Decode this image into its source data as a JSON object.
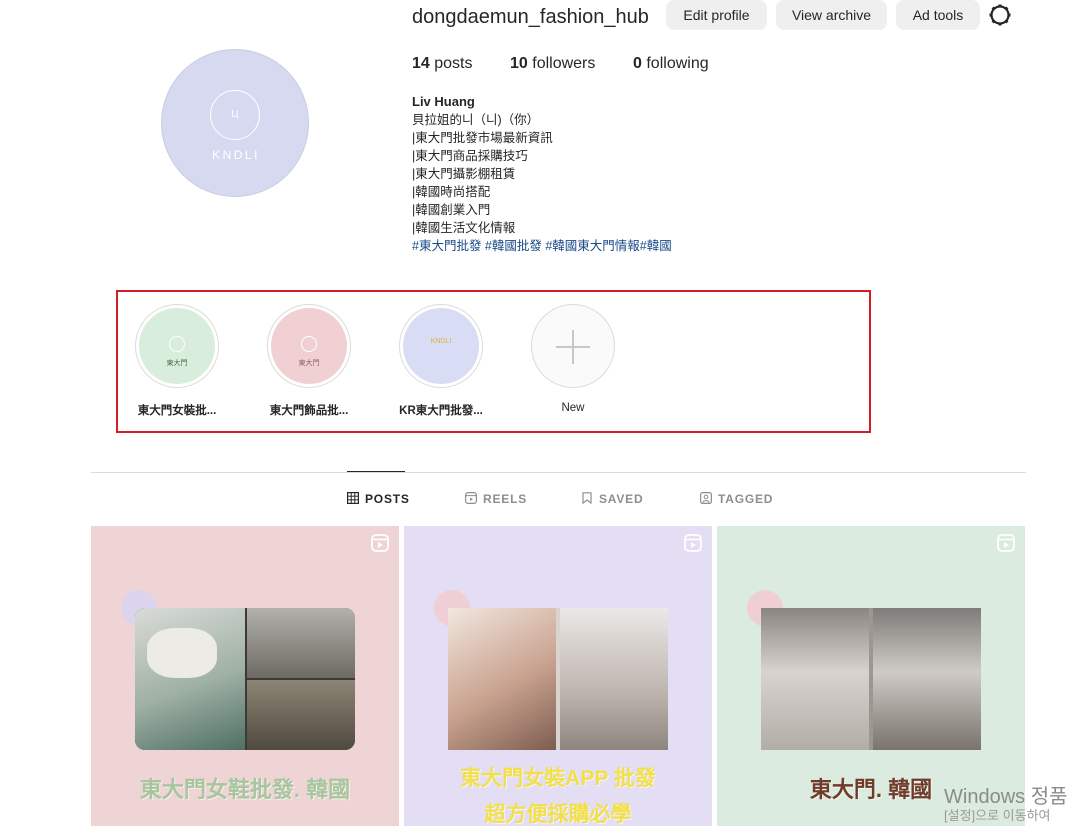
{
  "profile": {
    "username": "dongdaemun_fashion_hub",
    "avatar_text": "KNDLI",
    "avatar_badge": "Ц",
    "buttons": {
      "edit": "Edit profile",
      "archive": "View archive",
      "ad_tools": "Ad tools"
    },
    "stats": {
      "posts_count": "14",
      "posts_label": "posts",
      "followers_count": "10",
      "followers_label": "followers",
      "following_count": "0",
      "following_label": "following"
    },
    "bio": {
      "name": "Liv Huang",
      "lines": [
        "貝拉姐的니（니)（你）",
        "|東大門批發市場最新資訊",
        "|東大門商品採購技巧",
        "|東大門攝影棚租賃",
        "|韓國時尚搭配",
        "|韓國創業入門",
        "|韓國生活文化情報"
      ],
      "hashtags": "#東大門批發 #韓國批發 #韓國東大門情報#韓國"
    }
  },
  "highlights": [
    {
      "label": "東大門女裝批...",
      "color": "#d8eddc",
      "caption": "東大門",
      "caption_color": "#3f6b4a"
    },
    {
      "label": "東大門飾品批...",
      "color": "#f1d0d3",
      "caption": "東大門",
      "caption_color": "#8a5b5e"
    },
    {
      "label": "KR東大門批發...",
      "color": "#d9dcf5",
      "caption": "KNDLI",
      "caption_color": "#d9b53a"
    },
    {
      "label": "New"
    }
  ],
  "tabs": [
    {
      "label": "POSTS",
      "active": true
    },
    {
      "label": "REELS",
      "active": false
    },
    {
      "label": "SAVED",
      "active": false
    },
    {
      "label": "TAGGED",
      "active": false
    }
  ],
  "posts": [
    {
      "title": "東大門女鞋批發. 韓國",
      "title_color": "#a7c69d"
    },
    {
      "title_line1": "東大門女裝APP 批發",
      "title_line2": "超方便採購必學",
      "title_color": "#f2e04b"
    },
    {
      "title": "東大門. 韓國",
      "title_color": "#6f3b2a"
    }
  ],
  "os": {
    "watermark": "Windows 정품",
    "watermark_sub": "[설정]으로 이동하여"
  },
  "icons": {
    "settings": "gear-icon",
    "posts_tab": "grid-icon",
    "reels_tab": "reels-icon",
    "saved_tab": "bookmark-icon",
    "tagged_tab": "tag-person-icon",
    "new_highlight": "plus-icon",
    "reel_badge": "reel-icon"
  }
}
